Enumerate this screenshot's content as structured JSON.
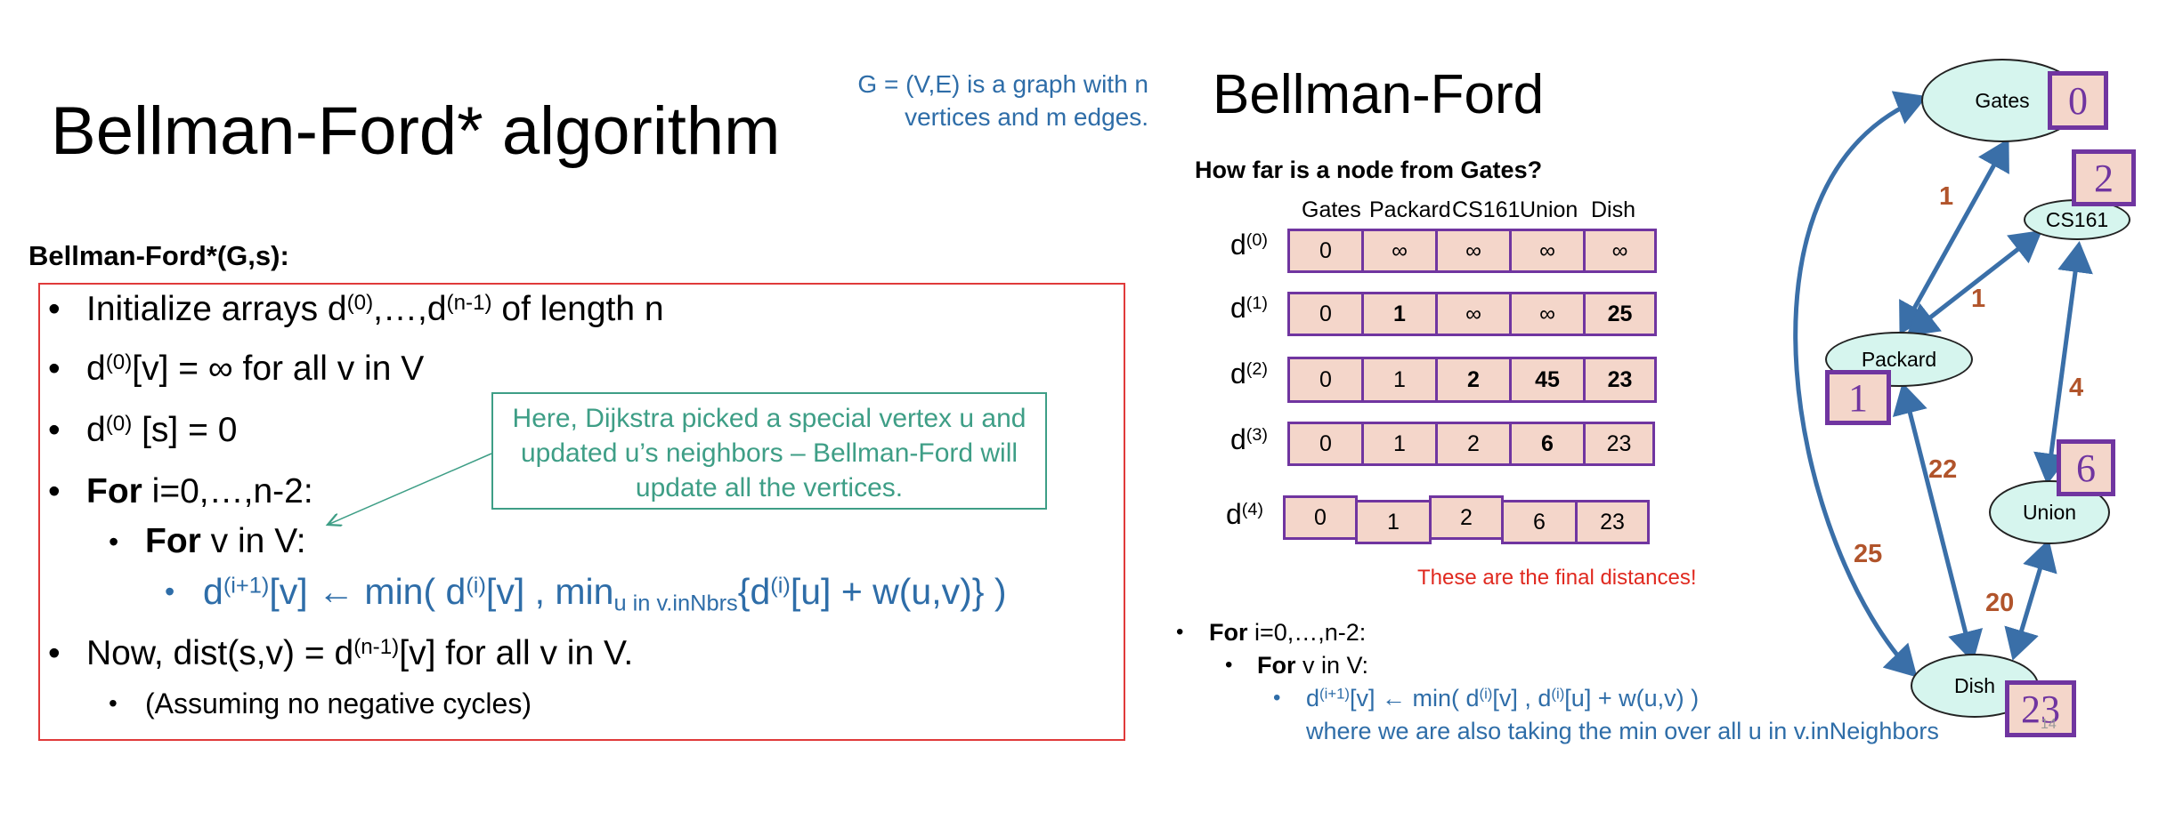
{
  "left": {
    "title": "Bellman-Ford* algorithm",
    "graph_note_line1": "G = (V,E) is a graph with n",
    "graph_note_line2": "vertices and m edges.",
    "algo_header": "Bellman-Ford*(G,s):",
    "line1_a": "Initialize arrays d",
    "line1_sup1": "(0)",
    "line1_b": ",…,d",
    "line1_sup2": "(n-1)",
    "line1_c": " of length n",
    "line2_a": "d",
    "line2_sup": "(0)",
    "line2_b": "[v] = ∞ for all v in V",
    "line3_a": "d",
    "line3_sup": "(0)",
    "line3_b": " [s] = 0",
    "line4_bold": "For",
    "line4_rest": " i=0,…,n-2:",
    "line5_bold": "For",
    "line5_rest": " v in V:",
    "line6_a": "d",
    "line6_sup1": "(i+1)",
    "line6_b": "[v] ← min( d",
    "line6_sup2": "(i)",
    "line6_c": "[v] , min",
    "line6_sub": "u in v.inNbrs",
    "line6_d": "{d",
    "line6_sup3": "(i)",
    "line6_e": "[u] + w(u,v)} )",
    "line7_a": "Now, dist(s,v) = d",
    "line7_sup": "(n-1)",
    "line7_b": "[v] for all v in V.",
    "line8": "(Assuming no negative cycles)",
    "dijkstra_note": "Here, Dijkstra picked a special vertex u and updated u’s neighbors – Bellman-Ford will update all the vertices."
  },
  "right": {
    "title": "Bellman-Ford",
    "question": "How far is a node from Gates?",
    "columns": [
      "Gates",
      "Packard",
      "CS161",
      "Union",
      "Dish"
    ],
    "rows": [
      {
        "label_base": "d",
        "label_sup": "(0)",
        "cells": [
          "0",
          "∞",
          "∞",
          "∞",
          "∞"
        ]
      },
      {
        "label_base": "d",
        "label_sup": "(1)",
        "cells": [
          "0",
          "1",
          "∞",
          "∞",
          "25"
        ]
      },
      {
        "label_base": "d",
        "label_sup": "(2)",
        "cells": [
          "0",
          "1",
          "2",
          "45",
          "23"
        ]
      },
      {
        "label_base": "d",
        "label_sup": "(3)",
        "cells": [
          "0",
          "1",
          "2",
          "6",
          "23"
        ]
      },
      {
        "label_base": "d",
        "label_sup": "(4)",
        "cells": [
          "0",
          "1",
          "2",
          "6",
          "23"
        ]
      }
    ],
    "final_note": "These are the final distances!",
    "loop_line1_bold": "For",
    "loop_line1_rest": " i=0,…,n-2:",
    "loop_line2_bold": "For",
    "loop_line2_rest": " v in V:",
    "loop_line3_a": "d",
    "loop_line3_sup1": "(i+1)",
    "loop_line3_b": "[v] ← min( d",
    "loop_line3_sup2": "(i)",
    "loop_line3_c": "[v] , d",
    "loop_line3_sup3": "(i)",
    "loop_line3_d": "[u] + w(u,v) )",
    "loop_line4": "where we are also taking the min over all u in v.inNeighbors"
  },
  "graph": {
    "nodes": {
      "gates": {
        "label": "Gates",
        "distance": "0"
      },
      "cs161": {
        "label": "CS161",
        "distance": "2"
      },
      "packard": {
        "label": "Packard",
        "distance": "1"
      },
      "union": {
        "label": "Union",
        "distance": "6"
      },
      "dish": {
        "label": "Dish",
        "distance": "23"
      }
    },
    "weights": {
      "gates_packard": "1",
      "packard_cs161": "1",
      "cs161_union": "4",
      "packard_dish": "22",
      "gates_dish": "25",
      "union_dish": "20"
    },
    "edge_color": "#3A6FA8",
    "node_fill": "#D6F5EE",
    "dist_box_border": "#7035A0",
    "dist_box_fill": "#F4D6CA",
    "weight_color": "#B1542B"
  },
  "page_number": "14"
}
